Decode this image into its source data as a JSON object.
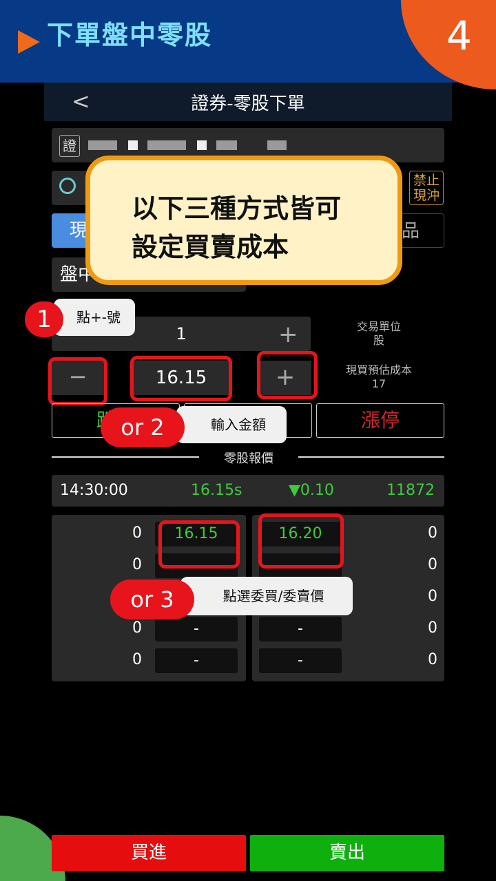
{
  "banner": {
    "title": "下單盤中零股",
    "step": "4"
  },
  "nav": {
    "back": "<",
    "title": "證券-零股下單"
  },
  "stock": {
    "tag": "證"
  },
  "tags": {
    "ban": "禁止現沖",
    "ban_line1": "禁止",
    "ban_line2": "現沖"
  },
  "tabs": {
    "spot": "現",
    "product": "品"
  },
  "session": "盤中",
  "callout": {
    "line1": "以下三種方式皆可",
    "line2": "設定買賣成本"
  },
  "order": {
    "quantity": "1",
    "price": "16.15",
    "unit_label": "交易單位",
    "unit_value": "股",
    "cost_label": "現買預估成本",
    "cost_value": "17",
    "limit_down_partial": "跌",
    "limit_up": "漲停"
  },
  "annotations": {
    "step1_num": "1",
    "step1_text": "點+-號",
    "step2_num": "or 2",
    "step2_text": "輸入金額",
    "step3_num": "or 3",
    "step3_text": "點選委買/委賣價"
  },
  "quote": {
    "section": "零股報價",
    "time": "14:30:00",
    "price": "16.15s",
    "change": "▼0.10",
    "volume": "11872"
  },
  "book": {
    "bids": [
      {
        "qty": "0",
        "price": "16.15"
      },
      {
        "qty": "0",
        "price": "-"
      },
      {
        "qty": "0",
        "price": "-"
      },
      {
        "qty": "0",
        "price": "-"
      },
      {
        "qty": "0",
        "price": "-"
      }
    ],
    "asks": [
      {
        "qty": "0",
        "price": "16.20"
      },
      {
        "qty": "0",
        "price": "-"
      },
      {
        "qty": "0",
        "price": "-"
      },
      {
        "qty": "0",
        "price": "-"
      },
      {
        "qty": "0",
        "price": "-"
      }
    ]
  },
  "actions": {
    "buy": "買進",
    "sell": "賣出"
  },
  "colors": {
    "banner": "#063a86",
    "accent": "#f06a1c",
    "highlight": "#e8141c",
    "buy": "#e50d0d",
    "sell": "#0db00d",
    "up_green": "#3ccc3c"
  }
}
